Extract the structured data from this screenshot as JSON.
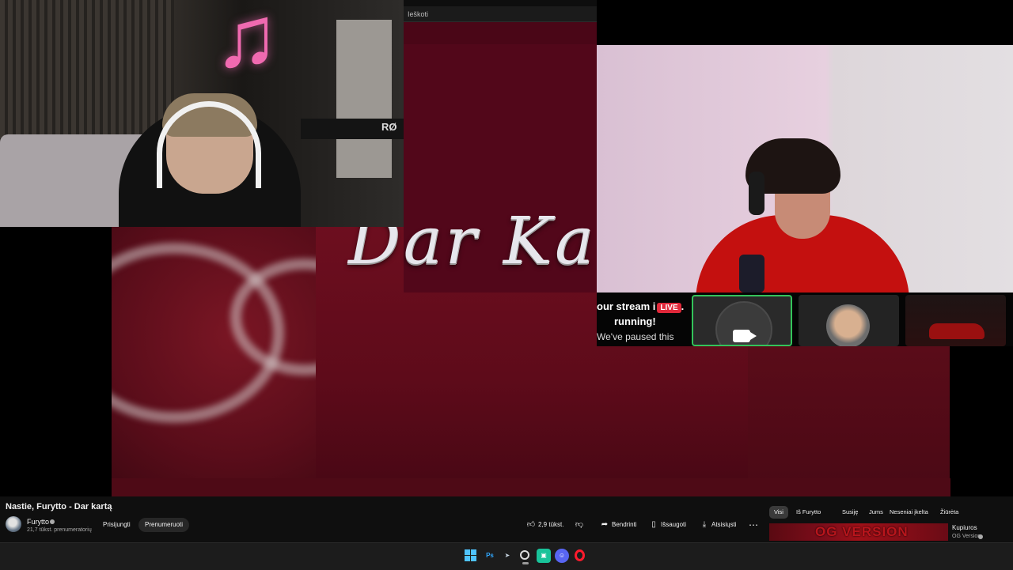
{
  "browser": {
    "search_placeholder": "Ieškoti"
  },
  "video_art": {
    "title_text": "Dar Ka"
  },
  "webcam_left": {
    "mic_brand": "RØ"
  },
  "stream_overlay": {
    "line1": "our stream i",
    "live_badge": "LIVE",
    "line1_end": ".",
    "line2": "running!",
    "line3": "We've paused this"
  },
  "video": {
    "title": "Nastie, Furytto - Dar kartą",
    "channel": "Furytto",
    "subscribers": "21,7 tūkst. prenumeratorių",
    "join_label": "Prisijungti",
    "subscribe_label": "Prenumeruoti",
    "likes": "2,9 tūkst.",
    "share_label": "Bendrinti",
    "save_label": "Išsaugoti",
    "download_label": "Atsisiųsti",
    "more_label": "⋯"
  },
  "chips": [
    "Visi",
    "Iš Furytto",
    "Susiję",
    "Jums",
    "Neseniai įkelta",
    "Žiūrėta"
  ],
  "recommended": {
    "thumb_text": "OG VERSION",
    "title": "Kupiuros",
    "subtitle": "OG Version"
  },
  "taskbar": {
    "ps_label": "Ps"
  },
  "colors": {
    "accent_live": "#e0283a",
    "art_maroon": "#5e0b1a",
    "active_tile_border": "#33c35a"
  }
}
